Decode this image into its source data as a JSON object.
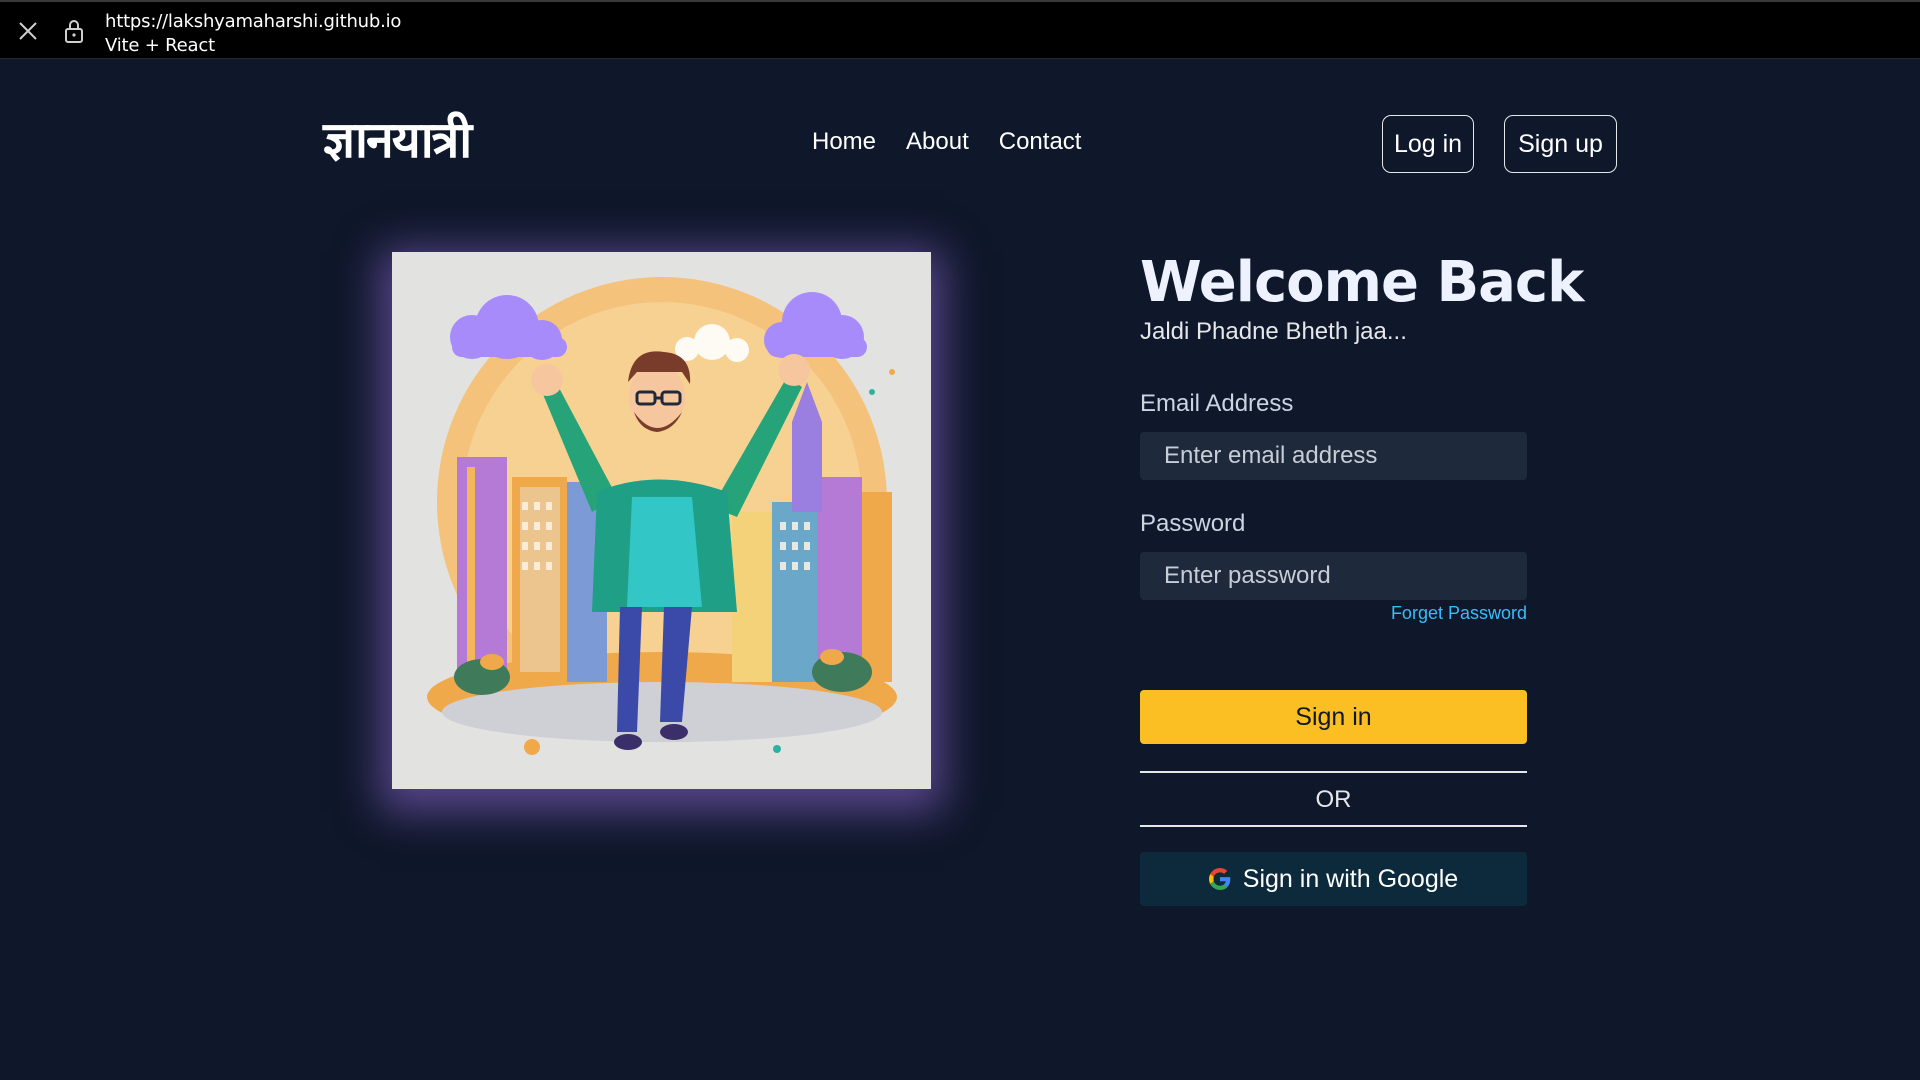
{
  "browser": {
    "url": "https://lakshyamaharshi.github.io",
    "tab_title": "Vite + React"
  },
  "navbar": {
    "logo": "ज्ञानयात्री",
    "links": [
      "Home",
      "About",
      "Contact"
    ],
    "login_label": "Log in",
    "signup_label": "Sign up"
  },
  "illustration": {
    "icon": "man-celebrating-city-illustration"
  },
  "form": {
    "title": "Welcome Back",
    "subtitle": "Jaldi Phadne Bheth jaa...",
    "email_label": "Email Address",
    "email_placeholder": "Enter email address",
    "password_label": "Password",
    "password_placeholder": "Enter password",
    "forgot_label": "Forget Password",
    "signin_label": "Sign in",
    "or_label": "OR",
    "google_label": "Sign in with Google"
  },
  "colors": {
    "background": "#0f172a",
    "accent": "#fbbf24",
    "link": "#38bdf8",
    "input_bg": "#1e293b",
    "google_bg": "#0c2a3b"
  }
}
